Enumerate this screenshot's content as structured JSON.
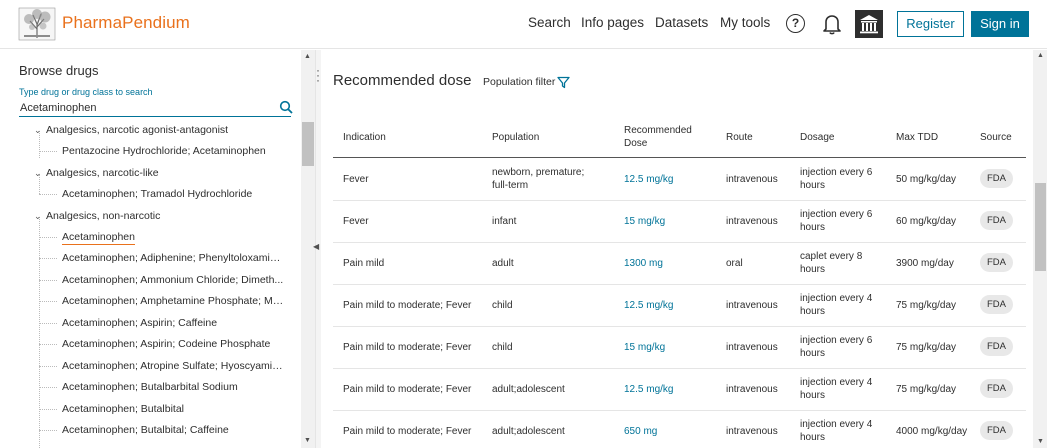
{
  "header": {
    "brand": "PharmaPendium",
    "nav": [
      "Search",
      "Info pages",
      "Datasets",
      "My tools"
    ],
    "help_glyph": "?",
    "register_label": "Register",
    "signin_label": "Sign in",
    "icons": [
      "elsevier-tree-logo",
      "help-icon",
      "bell-icon",
      "institution-icon"
    ]
  },
  "sidebar": {
    "title": "Browse drugs",
    "search_label": "Type drug or drug class to search",
    "search_value": "Acetaminophen",
    "tree": [
      {
        "type": "cat",
        "label": "Analgesics, narcotic agonist-antagonist"
      },
      {
        "type": "leaf",
        "label": "Pentazocine Hydrochloride; Acetaminophen"
      },
      {
        "type": "cat",
        "label": "Analgesics, narcotic-like"
      },
      {
        "type": "leaf",
        "label": "Acetaminophen; Tramadol Hydrochloride"
      },
      {
        "type": "cat",
        "label": "Analgesics, non-narcotic"
      },
      {
        "type": "leaf",
        "label": "Acetaminophen",
        "selected": true
      },
      {
        "type": "leaf",
        "label": "Acetaminophen; Adiphenine; Phenyltoloxamine..."
      },
      {
        "type": "leaf",
        "label": "Acetaminophen; Ammonium Chloride; Dimeth..."
      },
      {
        "type": "leaf",
        "label": "Acetaminophen; Amphetamine Phosphate; Met..."
      },
      {
        "type": "leaf",
        "label": "Acetaminophen; Aspirin; Caffeine"
      },
      {
        "type": "leaf",
        "label": "Acetaminophen; Aspirin; Codeine Phosphate"
      },
      {
        "type": "leaf",
        "label": "Acetaminophen; Atropine Sulfate; Hyoscyamin..."
      },
      {
        "type": "leaf",
        "label": "Acetaminophen; Butalbarbital Sodium"
      },
      {
        "type": "leaf",
        "label": "Acetaminophen; Butalbital"
      },
      {
        "type": "leaf",
        "label": "Acetaminophen; Butalbital; Caffeine"
      }
    ]
  },
  "main": {
    "title": "Recommended dose",
    "filter_label": "Population filter",
    "columns": [
      "Indication",
      "Population",
      "Recommended Dose",
      "Route",
      "Dosage",
      "Max TDD",
      "Source"
    ],
    "rows": [
      {
        "indication": "Fever",
        "population": "newborn, premature; full-term",
        "dose": "12.5 mg/kg",
        "route": "intravenous",
        "dosage": "injection every 6 hours",
        "max_tdd": "50 mg/kg/day",
        "source": "FDA"
      },
      {
        "indication": "Fever",
        "population": "infant",
        "dose": "15 mg/kg",
        "route": "intravenous",
        "dosage": "injection every 6 hours",
        "max_tdd": "60 mg/kg/day",
        "source": "FDA"
      },
      {
        "indication": "Pain mild",
        "population": "adult",
        "dose": "1300 mg",
        "route": "oral",
        "dosage": "caplet every 8 hours",
        "max_tdd": "3900 mg/day",
        "source": "FDA"
      },
      {
        "indication": "Pain mild to moderate; Fever",
        "population": "child",
        "dose": "12.5 mg/kg",
        "route": "intravenous",
        "dosage": "injection every 4 hours",
        "max_tdd": "75 mg/kg/day",
        "source": "FDA"
      },
      {
        "indication": "Pain mild to moderate; Fever",
        "population": "child",
        "dose": "15 mg/kg",
        "route": "intravenous",
        "dosage": "injection every 6 hours",
        "max_tdd": "75 mg/kg/day",
        "source": "FDA"
      },
      {
        "indication": "Pain mild to moderate; Fever",
        "population": "adult;adolescent",
        "dose": "12.5 mg/kg",
        "route": "intravenous",
        "dosage": "injection every 4 hours",
        "max_tdd": "75 mg/kg/day",
        "source": "FDA"
      },
      {
        "indication": "Pain mild to moderate; Fever",
        "population": "adult;adolescent",
        "dose": "650 mg",
        "route": "intravenous",
        "dosage": "injection every 4 hours",
        "max_tdd": "4000 mg/kg/day",
        "source": "FDA"
      }
    ]
  },
  "colors": {
    "accent": "#007398",
    "brand": "#e9711c",
    "text": "#2e2e2e"
  }
}
